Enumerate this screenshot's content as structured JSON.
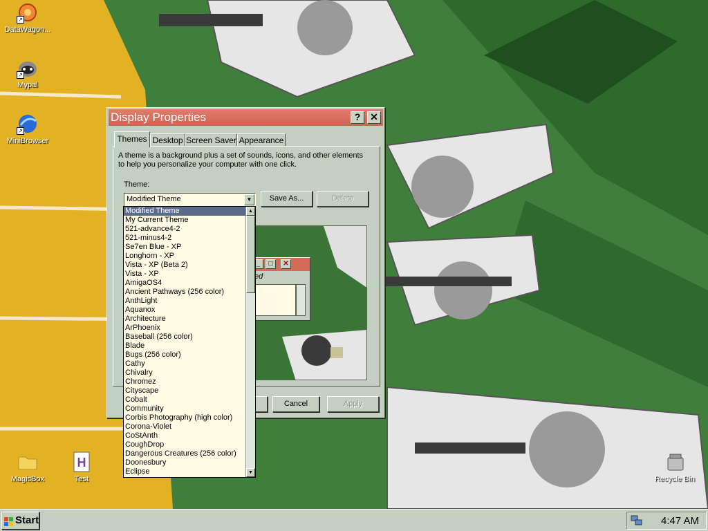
{
  "desktop": {
    "icons": [
      {
        "label": "DataWagon..."
      },
      {
        "label": "Mypal"
      },
      {
        "label": "MiniBrowser"
      },
      {
        "label": "MagicBox"
      },
      {
        "label": "Test"
      },
      {
        "label": "Recycle Bin"
      }
    ]
  },
  "window": {
    "title": "Display Properties",
    "help_glyph": "?",
    "close_glyph": "✕",
    "tabs": [
      {
        "label": "Themes"
      },
      {
        "label": "Desktop"
      },
      {
        "label": "Screen Saver"
      },
      {
        "label": "Appearance"
      }
    ],
    "description": "A theme is a background plus a set of sounds, icons, and other elements to help you personalize your computer with one click.",
    "theme_label": "Theme:",
    "theme_value": "Modified Theme",
    "save_as_label": "Save As...",
    "delete_label": "Delete",
    "cancel_label": "Cancel",
    "apply_label": "Apply",
    "preview_menu_text": "ed"
  },
  "dropdown": {
    "items": [
      "Modified Theme",
      "My Current Theme",
      "521-advance4-2",
      "521-minus4-2",
      "Se7en Blue - XP",
      "Longhorn - XP",
      "Vista - XP (Beta 2)",
      "Vista - XP",
      "AmigaOS4",
      "Ancient Pathways (256 color)",
      "AnthLight",
      "Aquanox",
      "Architecture",
      "ArPhoenix",
      "Baseball (256 color)",
      "Blade",
      "Bugs (256 color)",
      "Cathy",
      "Chivalry",
      "Chromez",
      "Cityscape",
      "Cobalt",
      "Community",
      "Corbis Photography (high color)",
      "Corona-Violet",
      "CoStAnth",
      "CoughDrop",
      "Dangerous Creatures (256 color)",
      "Doonesbury",
      "Eclipse"
    ],
    "selected_index": 0
  },
  "taskbar": {
    "start_label": "Start",
    "clock": "4:47 AM"
  },
  "colors": {
    "titlebar": "#d46a58",
    "face": "#c4d0bf",
    "selection": "#5c6a8c",
    "field": "#fffbe5"
  }
}
